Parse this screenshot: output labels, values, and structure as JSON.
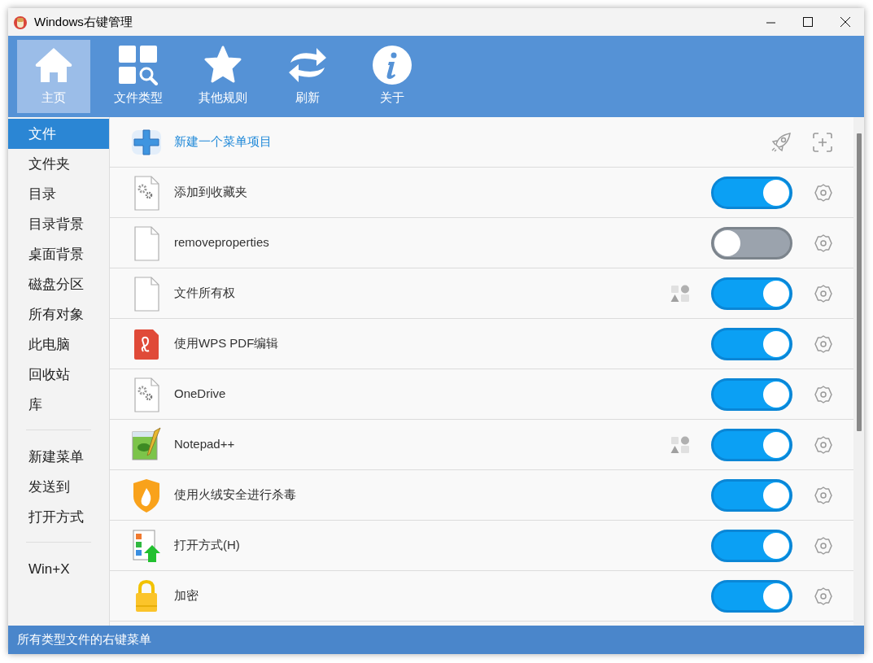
{
  "window": {
    "title": "Windows右键管理"
  },
  "toolbar": [
    {
      "label": "主页",
      "selected": true
    },
    {
      "label": "文件类型",
      "selected": false
    },
    {
      "label": "其他规则",
      "selected": false
    },
    {
      "label": "刷新",
      "selected": false
    },
    {
      "label": "关于",
      "selected": false
    }
  ],
  "sidebar": {
    "groups": [
      [
        {
          "label": "文件",
          "selected": true
        },
        {
          "label": "文件夹",
          "selected": false
        },
        {
          "label": "目录",
          "selected": false
        },
        {
          "label": "目录背景",
          "selected": false
        },
        {
          "label": "桌面背景",
          "selected": false
        },
        {
          "label": "磁盘分区",
          "selected": false
        },
        {
          "label": "所有对象",
          "selected": false
        },
        {
          "label": "此电脑",
          "selected": false
        },
        {
          "label": "回收站",
          "selected": false
        },
        {
          "label": "库",
          "selected": false
        }
      ],
      [
        {
          "label": "新建菜单",
          "selected": false
        },
        {
          "label": "发送到",
          "selected": false
        },
        {
          "label": "打开方式",
          "selected": false
        }
      ],
      [
        {
          "label": "Win+X",
          "selected": false
        }
      ]
    ]
  },
  "new_item": {
    "label": "新建一个菜单项目"
  },
  "rows": [
    {
      "kind": "file-gear",
      "label": "添加到收藏夹",
      "on": true,
      "shapes": false
    },
    {
      "kind": "file",
      "label": "removeproperties",
      "on": false,
      "shapes": false
    },
    {
      "kind": "file",
      "label": "文件所有权",
      "on": true,
      "shapes": true
    },
    {
      "kind": "pdf",
      "label": "使用WPS PDF编辑",
      "on": true,
      "shapes": false
    },
    {
      "kind": "file-gear",
      "label": "OneDrive",
      "on": true,
      "shapes": false
    },
    {
      "kind": "notepad",
      "label": "Notepad++",
      "on": true,
      "shapes": true
    },
    {
      "kind": "shield",
      "label": "使用火绒安全进行杀毒",
      "on": true,
      "shapes": false
    },
    {
      "kind": "open-with",
      "label": "打开方式(H)",
      "on": true,
      "shapes": false
    },
    {
      "kind": "lock",
      "label": "加密",
      "on": true,
      "shapes": false
    }
  ],
  "status_bar": "所有类型文件的右键菜单"
}
